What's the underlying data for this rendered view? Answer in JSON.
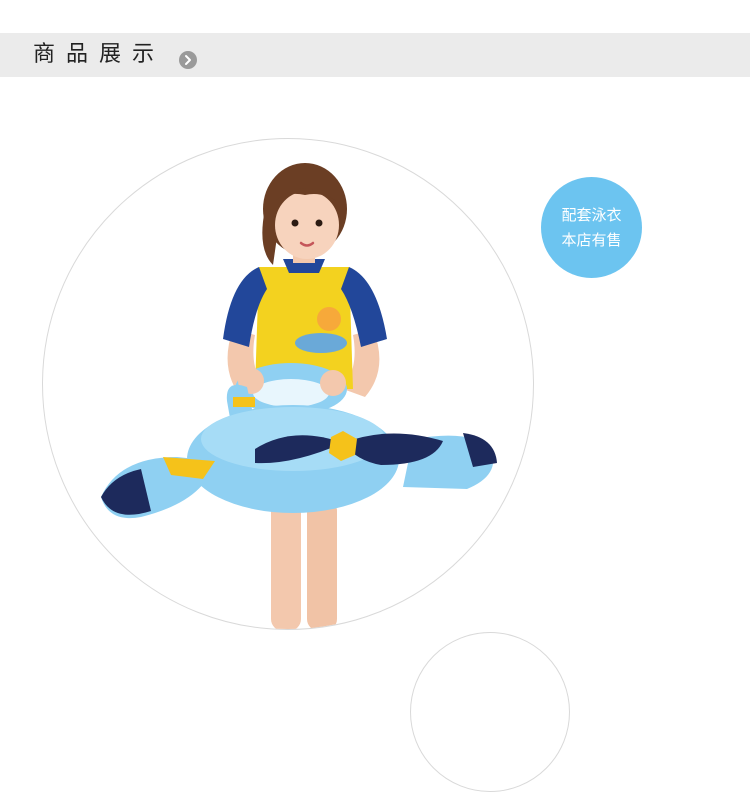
{
  "header": {
    "title": "商品展示",
    "arrow_icon": "chevron-right-circle-icon"
  },
  "badge": {
    "line1": "配套泳衣",
    "line2": "本店有售",
    "color": "#6cc4f0"
  },
  "product_image": {
    "subject": "child-with-airplane-swim-ring",
    "colors": {
      "ring": "#8fd0f2",
      "propeller": "#1d2a5c",
      "accent": "#f5c21a",
      "shirt": "#f3d21f",
      "sleeves": "#22479a"
    }
  },
  "colors": {
    "header_bg": "#ebebeb",
    "header_text": "#222222",
    "circle_border": "#d9d9d9"
  }
}
